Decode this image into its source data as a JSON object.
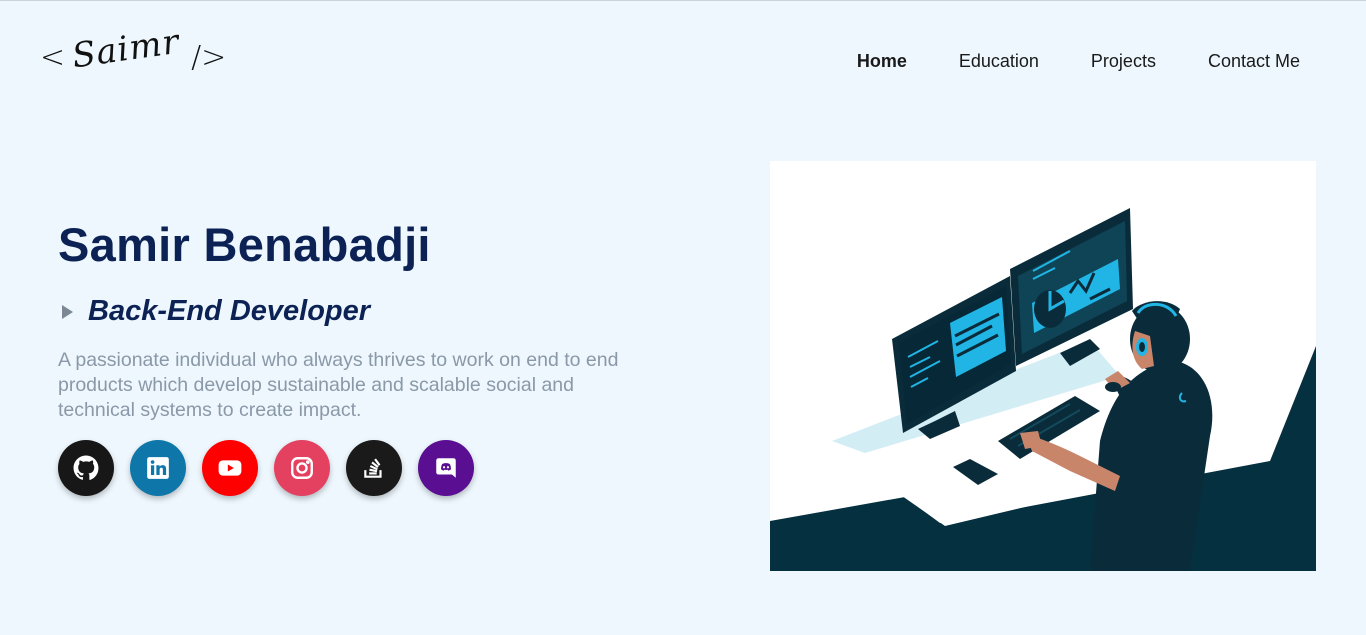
{
  "header": {
    "logo": {
      "left_bracket": "<",
      "signature": "Saimr",
      "right_bracket": "/>"
    },
    "nav": [
      {
        "label": "Home",
        "active": true
      },
      {
        "label": "Education",
        "active": false
      },
      {
        "label": "Projects",
        "active": false
      },
      {
        "label": "Contact Me",
        "active": false
      }
    ]
  },
  "hero": {
    "name": "Samir Benabadji",
    "role": "Back-End Developer",
    "description": "A passionate individual who always thrives to work on end to end products which develop sustainable and scalable social and technical systems to create impact."
  },
  "socials": [
    {
      "name": "github",
      "icon": "github-icon",
      "color": "#181717"
    },
    {
      "name": "linkedin",
      "icon": "linkedin-icon",
      "color": "#0e76a8"
    },
    {
      "name": "youtube",
      "icon": "youtube-icon",
      "color": "#ff0000"
    },
    {
      "name": "instagram",
      "icon": "instagram-icon",
      "color": "#e4405f"
    },
    {
      "name": "stackoverflow",
      "icon": "stackoverflow-icon",
      "color": "#1a1a1a"
    },
    {
      "name": "discord",
      "icon": "discord-icon",
      "color": "#5a0e91"
    }
  ],
  "colors": {
    "background": "#edf7fd",
    "heading": "#0c2255",
    "text_muted": "#8a98a8",
    "illustration_dark": "#05303f",
    "illustration_accent": "#21b5e5"
  }
}
